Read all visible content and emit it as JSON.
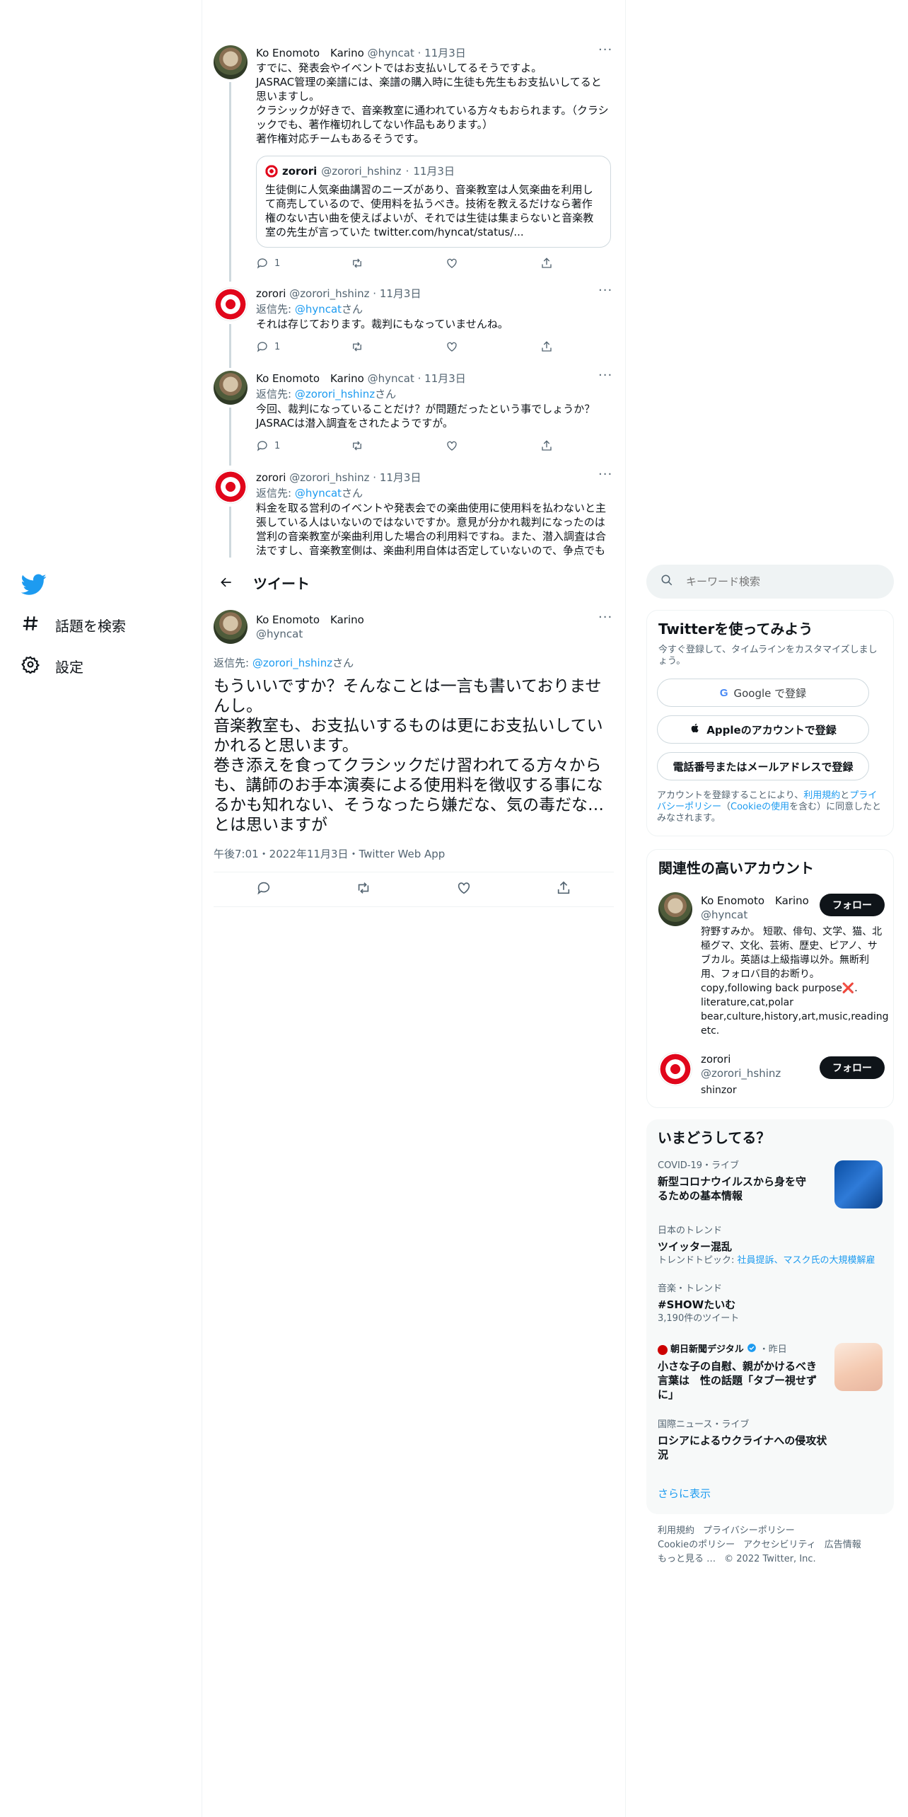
{
  "nav": {
    "items": [
      {
        "label": "話題を検索",
        "icon": "hashtag-icon"
      },
      {
        "label": "設定",
        "icon": "gear-icon"
      }
    ]
  },
  "header": {
    "title": "ツイート",
    "back_icon": "back-arrow-icon"
  },
  "thread": [
    {
      "display_name": "Ko Enomoto　Karino",
      "handle": "@hyncat",
      "date": "11月3日",
      "text": "すでに、発表会やイベントではお支払いしてるそうですよ。\nJASRAC管理の楽譜には、楽譜の購入時に生徒も先生もお支払いしてると思いますし。\nクラシックが好きで、音楽教室に通われている方々もおられます。（クラシックでも、著作権切れしてない作品もあります。）\n著作権対応チームもあるそうです。",
      "quote": {
        "display_name": "zorori",
        "handle": "@zorori_hshinz",
        "date": "11月3日",
        "text": "生徒側に人気楽曲講習のニーズがあり、音楽教室は人気楽曲を利用して商売しているので、使用料を払うべき。技術を教えるだけなら著作権のない古い曲を使えばよいが、それでは生徒は集まらないと音楽教室の先生が言っていた twitter.com/hyncat/status/..."
      },
      "reply_count": "1"
    },
    {
      "display_name": "zorori",
      "handle": "@zorori_hshinz",
      "date": "11月3日",
      "reply_prefix": "返信先: ",
      "reply_user": "@hyncat",
      "reply_suffix": "さん",
      "text": "それは存じております。裁判にもなっていませんね。",
      "reply_count": "1"
    },
    {
      "display_name": "Ko Enomoto　Karino",
      "handle": "@hyncat",
      "date": "11月3日",
      "reply_prefix": "返信先: ",
      "reply_user": "@zorori_hshinz",
      "reply_suffix": "さん",
      "text": "今回、裁判になっていることだけ？が問題だったという事でしょうか？\nJASRACは潜入調査をされたようですが。",
      "reply_count": "1"
    },
    {
      "display_name": "zorori",
      "handle": "@zorori_hshinz",
      "date": "11月3日",
      "reply_prefix": "返信先: ",
      "reply_user": "@hyncat",
      "reply_suffix": "さん",
      "text": "料金を取る営利のイベントや発表会での楽曲使用に使用料を払わないと主張している人はいないのではないですか。意見が分かれ裁判になったのは営利の音楽教室が楽曲利用した場合の利用料ですね。また、潜入調査は合法ですし、音楽教室側は、楽曲利用自体は否定していないので、争点でもありません。"
    }
  ],
  "main_tweet": {
    "display_name": "Ko Enomoto　Karino",
    "handle": "@hyncat",
    "reply_prefix": "返信先: ",
    "reply_user": "@zorori_hshinz",
    "reply_suffix": "さん",
    "text": "もういいですか？そんなことは一言も書いておりませんし。\n音楽教室も、お支払いするものは更にお支払いしていかれると思います。\n巻き添えを食ってクラシックだけ習われてる方々からも、講師のお手本演奏による使用料を徴収する事になるかも知れない、そうなったら嫌だな、気の毒だな…とは思いますが",
    "meta": "午後7:01・2022年11月3日・Twitter Web App"
  },
  "search": {
    "placeholder": "キーワード検索"
  },
  "signup": {
    "title": "Twitterを使ってみよう",
    "subtitle": "今すぐ登録して、タイムラインをカスタマイズしましょう。",
    "google": "Google で登録",
    "apple": "Appleのアカウントで登録",
    "phone": "電話番号またはメールアドレスで登録",
    "terms_pre": "アカウントを登録することにより、",
    "terms_link1": "利用規約",
    "terms_mid": "と",
    "terms_link2": "プライバシーポリシー",
    "terms_paren_open": "（",
    "terms_link3": "Cookieの使用",
    "terms_post": "を含む）に同意したとみなされます。"
  },
  "related": {
    "title": "関連性の高いアカウント",
    "accounts": [
      {
        "display_name": "Ko Enomoto　Karino",
        "handle": "@hyncat",
        "follow": "フォロー",
        "bio": "狩野すみか。 短歌、俳句、文学、猫、北極グマ、文化、芸術、歴史、ピアノ、サブカル。英語は上級指導以外。無断利用、フォロバ目的お断り。copy,following back purpose❌. literature,cat,polar bear,culture,history,art,music,reading etc."
      },
      {
        "display_name": "zorori",
        "handle": "@zorori_hshinz",
        "follow": "フォロー",
        "bio": "shinzor"
      }
    ]
  },
  "trends": {
    "title": "いまどうしてる？",
    "items": [
      {
        "context": "COVID-19・ライブ",
        "title": "新型コロナウイルスから身を守るための基本情報"
      },
      {
        "context": "日本のトレンド",
        "title": "ツイッター混乱",
        "topics_label": "トレンドトピック: ",
        "topics": "社員提訴、マスク氏の大規模解雇"
      },
      {
        "context": "音楽・トレンド",
        "title": "#SHOWたいむ",
        "count": "3,190件のツイート"
      },
      {
        "context_name": "朝日新聞デジタル",
        "context_time": "・昨日",
        "title": "小さな子の自慰、親がかけるべき言葉は　性の話題「タブー視せずに」"
      },
      {
        "context": "国際ニュース・ライブ",
        "title": "ロシアによるウクライナへの侵攻状況"
      }
    ],
    "show_more": "さらに表示"
  },
  "footer": {
    "line1": [
      "利用規約",
      "プライバシーポリシー"
    ],
    "line2": [
      "Cookieのポリシー",
      "アクセシビリティ",
      "広告情報"
    ],
    "more": "もっと見る …",
    "copyright": "© 2022 Twitter, Inc."
  },
  "colors": {
    "accent": "#1d9bf0",
    "text": "#0f1419",
    "muted": "#536471",
    "border": "#eff3f4"
  }
}
